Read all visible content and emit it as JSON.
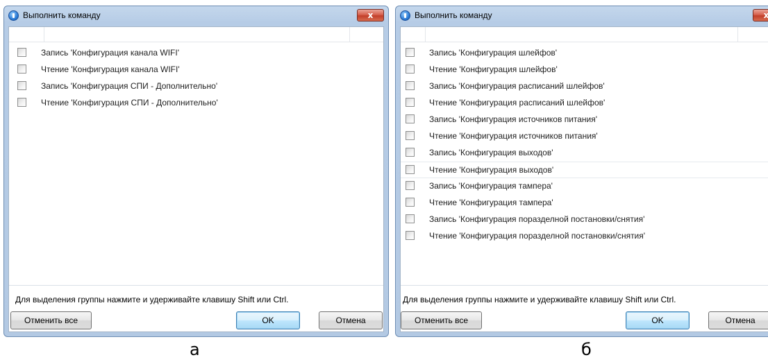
{
  "dialogs": [
    {
      "title": "Выполнить команду",
      "close_glyph": "x",
      "items": [
        {
          "label": "Запись 'Конфигурация канала WIFI'",
          "checked": false
        },
        {
          "label": "Чтение 'Конфигурация канала WIFI'",
          "checked": false
        },
        {
          "label": "Запись 'Конфигурация СПИ - Дополнительно'",
          "checked": false
        },
        {
          "label": "Чтение 'Конфигурация СПИ - Дополнительно'",
          "checked": false
        }
      ],
      "hint": "Для выделения группы нажмите и удерживайте клавишу Shift или Ctrl.",
      "buttons": {
        "clear_all": "Отменить все",
        "ok": "OK",
        "cancel": "Отмена"
      }
    },
    {
      "title": "Выполнить команду",
      "close_glyph": "x",
      "items": [
        {
          "label": "Запись 'Конфигурация шлейфов'",
          "checked": false
        },
        {
          "label": "Чтение 'Конфигурация шлейфов'",
          "checked": false
        },
        {
          "label": "Запись 'Конфигурация расписаний шлейфов'",
          "checked": false
        },
        {
          "label": "Чтение 'Конфигурация расписаний шлейфов'",
          "checked": false
        },
        {
          "label": "Запись 'Конфигурация источников питания'",
          "checked": false
        },
        {
          "label": "Чтение 'Конфигурация источников питания'",
          "checked": false
        },
        {
          "label": "Запись 'Конфигурация выходов'",
          "checked": false
        },
        {
          "label": "Чтение 'Конфигурация выходов'",
          "checked": false
        },
        {
          "label": "Запись 'Конфигурация тампера'",
          "checked": false
        },
        {
          "label": "Чтение 'Конфигурация тампера'",
          "checked": false
        },
        {
          "label": "Запись 'Конфигурация поразделной постановки/снятия'",
          "checked": false
        },
        {
          "label": "Чтение 'Конфигурация поразделной постановки/снятия'",
          "checked": false
        }
      ],
      "hint": "Для выделения группы нажмите и удерживайте клавишу Shift или Ctrl.",
      "buttons": {
        "clear_all": "Отменить все",
        "ok": "OK",
        "cancel": "Отмена"
      }
    }
  ],
  "captions": [
    "а",
    "б"
  ]
}
